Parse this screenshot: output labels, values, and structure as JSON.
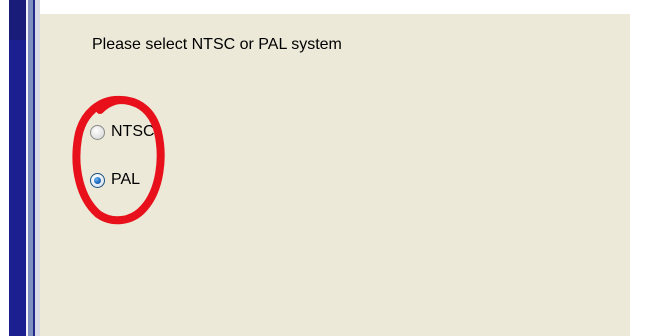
{
  "dialog": {
    "prompt": "Please select NTSC or PAL system",
    "options": [
      {
        "label": "NTSC",
        "selected": false
      },
      {
        "label": "PAL",
        "selected": true
      }
    ]
  },
  "annotation": {
    "shape": "hand-drawn ellipse",
    "color": "#e8101a"
  },
  "colors": {
    "panel_background": "#ece9d8",
    "frame_dark_blue": "#1c1f8f",
    "radio_selected_blue": "#1f6fc4"
  }
}
